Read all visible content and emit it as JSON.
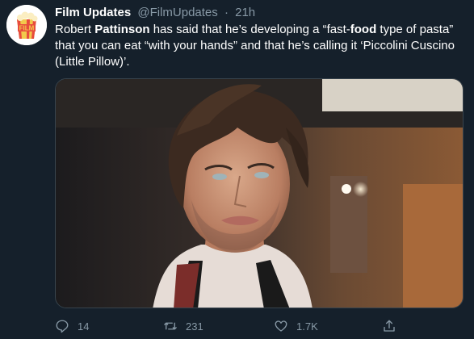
{
  "tweet": {
    "author_name": "Film Updates",
    "author_handle": "@FilmUpdates",
    "separator": "·",
    "time": "21h",
    "text_parts": [
      "Robert ",
      "Pattinson",
      " has said that he’s developing a “fast-",
      "food",
      " type of pasta” that you can eat “with your hands” and that he’s calling it ‘Piccolini Cuscino (Little Pillow)’."
    ],
    "avatar_logo_text": "FILM",
    "media_icon": "photo-portrait",
    "replies": "14",
    "retweets": "231",
    "likes": "1.7K"
  },
  "icons": {
    "reply": "reply-icon",
    "retweet": "retweet-icon",
    "like": "heart-icon",
    "share": "share-icon"
  },
  "colors": {
    "background": "#15202b",
    "muted": "#8899a6",
    "text": "#ffffff"
  }
}
